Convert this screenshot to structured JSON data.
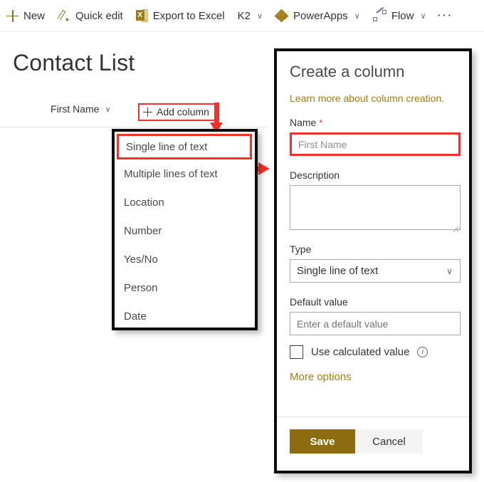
{
  "commandbar": {
    "items": [
      {
        "label": "New",
        "icon": "plus-icon",
        "has_chevron": false
      },
      {
        "label": "Quick edit",
        "icon": "pencil-icon",
        "has_chevron": false
      },
      {
        "label": "Export to Excel",
        "icon": "excel-icon",
        "has_chevron": false
      },
      {
        "label": "K2",
        "icon": "",
        "has_chevron": true
      },
      {
        "label": "PowerApps",
        "icon": "powerapps-icon",
        "has_chevron": true
      },
      {
        "label": "Flow",
        "icon": "flow-icon",
        "has_chevron": true
      }
    ],
    "overflow_label": "···",
    "chevron_glyph": "∨"
  },
  "page": {
    "title": "Contact List",
    "column_header": "First Name",
    "column_header_chevron": "∨",
    "add_column_label": "Add column"
  },
  "type_dropdown": {
    "items": [
      "Single line of text",
      "Multiple lines of text",
      "Location",
      "Number",
      "Yes/No",
      "Person",
      "Date"
    ],
    "selected_index": 0
  },
  "create_panel": {
    "title": "Create a column",
    "learn_more_link": "Learn more about column creation.",
    "name_label": "Name",
    "name_required_mark": "*",
    "name_value": "First Name",
    "description_label": "Description",
    "description_value": "",
    "type_label": "Type",
    "type_value": "Single line of text",
    "type_chevron": "∨",
    "default_value_label": "Default value",
    "default_value_placeholder": "Enter a default value",
    "use_calculated_label": "Use calculated value",
    "use_calculated_checked": false,
    "info_glyph": "i",
    "more_options_link": "More options",
    "save_label": "Save",
    "cancel_label": "Cancel"
  },
  "annotations": {
    "accent_red": "#f3312b",
    "accent_gold": "#8d6c11",
    "link_gold": "#a07d12",
    "down_arrow_target": "Add column",
    "right_arrow_target": "Name field"
  }
}
